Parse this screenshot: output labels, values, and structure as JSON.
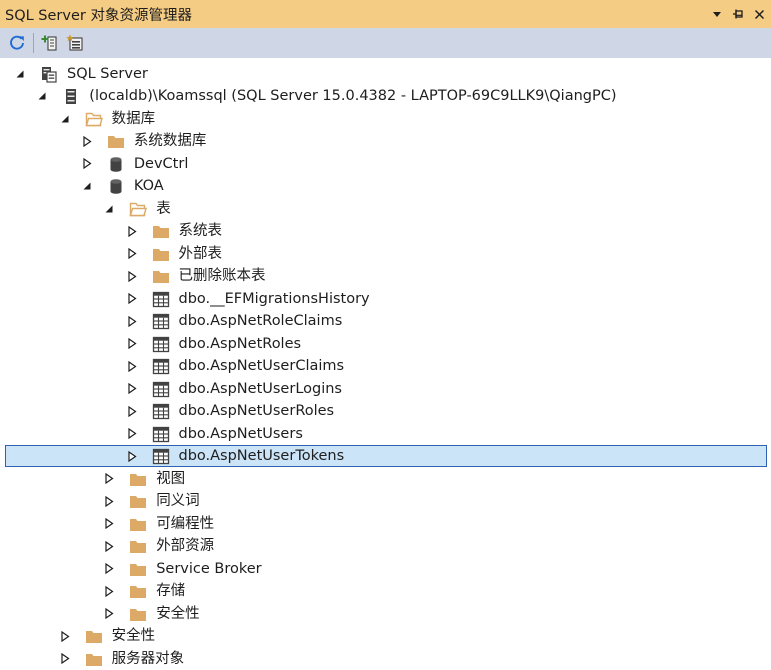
{
  "window": {
    "title": "SQL Server 对象资源管理器"
  },
  "toolbar": {
    "buttons": [
      {
        "name": "refresh-button",
        "icon": "refresh-icon"
      },
      {
        "name": "add-sql-server-button",
        "icon": "add-server-icon"
      },
      {
        "name": "new-query-button",
        "icon": "new-query-icon"
      }
    ]
  },
  "colors": {
    "titlebar": "#f5cc84",
    "toolbar": "#cfd6e5",
    "folder": "#dcaa66",
    "selection": "#cce4f7",
    "selection_border": "#2e62b3"
  },
  "tree": [
    {
      "label": "SQL Server",
      "level": 0,
      "expanded": true,
      "icon": "sql-server-icon",
      "selected": false
    },
    {
      "label": "(localdb)\\Koamssql (SQL Server 15.0.4382 - LAPTOP-69C9LLK9\\QiangPC)",
      "level": 1,
      "expanded": true,
      "icon": "server-instance-icon",
      "selected": false
    },
    {
      "label": "数据库",
      "level": 2,
      "expanded": true,
      "icon": "folder-open-icon",
      "selected": false
    },
    {
      "label": "系统数据库",
      "level": 3,
      "expanded": false,
      "icon": "folder-icon",
      "selected": false
    },
    {
      "label": "DevCtrl",
      "level": 3,
      "expanded": false,
      "icon": "database-icon",
      "selected": false
    },
    {
      "label": "KOA",
      "level": 3,
      "expanded": true,
      "icon": "database-icon",
      "selected": false
    },
    {
      "label": "表",
      "level": 4,
      "expanded": true,
      "icon": "folder-open-icon",
      "selected": false
    },
    {
      "label": "系统表",
      "level": 5,
      "expanded": false,
      "icon": "folder-icon",
      "selected": false
    },
    {
      "label": "外部表",
      "level": 5,
      "expanded": false,
      "icon": "folder-icon",
      "selected": false
    },
    {
      "label": "已删除账本表",
      "level": 5,
      "expanded": false,
      "icon": "folder-icon",
      "selected": false
    },
    {
      "label": "dbo.__EFMigrationsHistory",
      "level": 5,
      "expanded": false,
      "icon": "table-icon",
      "selected": false
    },
    {
      "label": "dbo.AspNetRoleClaims",
      "level": 5,
      "expanded": false,
      "icon": "table-icon",
      "selected": false
    },
    {
      "label": "dbo.AspNetRoles",
      "level": 5,
      "expanded": false,
      "icon": "table-icon",
      "selected": false
    },
    {
      "label": "dbo.AspNetUserClaims",
      "level": 5,
      "expanded": false,
      "icon": "table-icon",
      "selected": false
    },
    {
      "label": "dbo.AspNetUserLogins",
      "level": 5,
      "expanded": false,
      "icon": "table-icon",
      "selected": false
    },
    {
      "label": "dbo.AspNetUserRoles",
      "level": 5,
      "expanded": false,
      "icon": "table-icon",
      "selected": false
    },
    {
      "label": "dbo.AspNetUsers",
      "level": 5,
      "expanded": false,
      "icon": "table-icon",
      "selected": false
    },
    {
      "label": "dbo.AspNetUserTokens",
      "level": 5,
      "expanded": false,
      "icon": "table-icon",
      "selected": true
    },
    {
      "label": "视图",
      "level": 4,
      "expanded": false,
      "icon": "folder-icon",
      "selected": false
    },
    {
      "label": "同义词",
      "level": 4,
      "expanded": false,
      "icon": "folder-icon",
      "selected": false
    },
    {
      "label": "可编程性",
      "level": 4,
      "expanded": false,
      "icon": "folder-icon",
      "selected": false
    },
    {
      "label": "外部资源",
      "level": 4,
      "expanded": false,
      "icon": "folder-icon",
      "selected": false
    },
    {
      "label": "Service Broker",
      "level": 4,
      "expanded": false,
      "icon": "folder-icon",
      "selected": false
    },
    {
      "label": "存储",
      "level": 4,
      "expanded": false,
      "icon": "folder-icon",
      "selected": false
    },
    {
      "label": "安全性",
      "level": 4,
      "expanded": false,
      "icon": "folder-icon",
      "selected": false
    },
    {
      "label": "安全性",
      "level": 2,
      "expanded": false,
      "icon": "folder-icon",
      "selected": false
    },
    {
      "label": "服务器对象",
      "level": 2,
      "expanded": false,
      "icon": "folder-icon",
      "selected": false
    }
  ]
}
